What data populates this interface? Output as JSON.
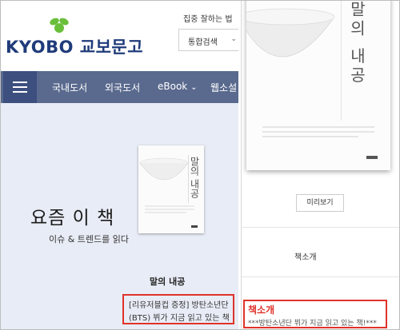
{
  "header": {
    "logo_latin": "KYOBO",
    "logo_korean": "교보문고",
    "slogan": "집중 잘하는 법",
    "search_scope": "통합검색"
  },
  "nav": {
    "items": [
      "국내도서",
      "외국도서",
      "eBook",
      "웹소설"
    ]
  },
  "hero": {
    "title": "요즘 이 책",
    "subtitle": "이슈 & 트렌드를 읽다"
  },
  "featured_book": {
    "title": "말의 내공",
    "cover_title": "말의 내공",
    "description_line1": "[리유저블컵 증정] 방탄소년단",
    "description_line2": "(BTS) 뷔가 지금 읽고 있는 책"
  },
  "detail": {
    "cover_title": "말의 내공",
    "preview_label": "미리보기",
    "tab_intro": "책소개",
    "intro_heading": "책소개",
    "intro_text": "***방탄소년단 뷔가 지금 읽고 있는 책!***"
  },
  "colors": {
    "brand_blue": "#1f3b7a",
    "logo_green": "#6abf3a",
    "nav_bg": "#5a6a8e",
    "hero_bg": "#e8ecf6",
    "highlight_red": "#e0332b"
  }
}
